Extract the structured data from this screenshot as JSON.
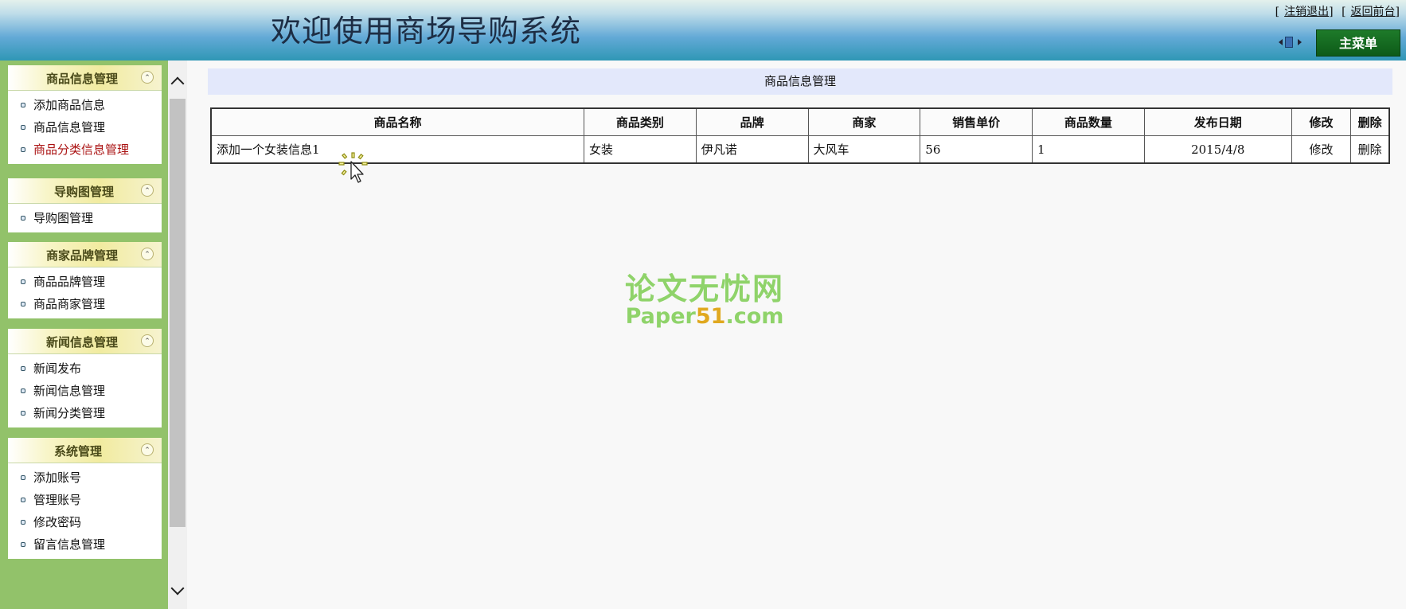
{
  "header": {
    "title": "欢迎使用商场导购系统",
    "logout_label": "注销退出",
    "front_label": "返回前台",
    "main_menu_label": "主菜单"
  },
  "sidebar": {
    "sections": [
      {
        "title": "商品信息管理",
        "items": [
          "添加商品信息",
          "商品信息管理",
          "商品分类信息管理"
        ],
        "active_index": 2
      },
      {
        "title": "导购图管理",
        "items": [
          "导购图管理"
        ]
      },
      {
        "title": "商家品牌管理",
        "items": [
          "商品品牌管理",
          "商品商家管理"
        ]
      },
      {
        "title": "新闻信息管理",
        "items": [
          "新闻发布",
          "新闻信息管理",
          "新闻分类管理"
        ]
      },
      {
        "title": "系统管理",
        "items": [
          "添加账号",
          "管理账号",
          "修改密码",
          "留言信息管理"
        ]
      }
    ]
  },
  "main": {
    "title": "商品信息管理",
    "table": {
      "headers": [
        "商品名称",
        "商品类别",
        "品牌",
        "商家",
        "销售单价",
        "商品数量",
        "发布日期",
        "修改",
        "删除"
      ],
      "rows": [
        [
          "添加一个女装信息1",
          "女装",
          "伊凡诺",
          "大风车",
          "56",
          "1",
          "2015/4/8",
          "修改",
          "删除"
        ]
      ]
    }
  },
  "watermark": {
    "line1": "论文无忧网",
    "line2_a": "Paper",
    "line2_b": "51",
    "line2_c": ".com"
  },
  "colors": {
    "sidebar_bg": "#92c26a",
    "header_accent": "#2f97b5",
    "main_menu_bg": "#0d5b18",
    "active_item": "#aa1111",
    "content_title_bg": "#e3e8fb"
  }
}
